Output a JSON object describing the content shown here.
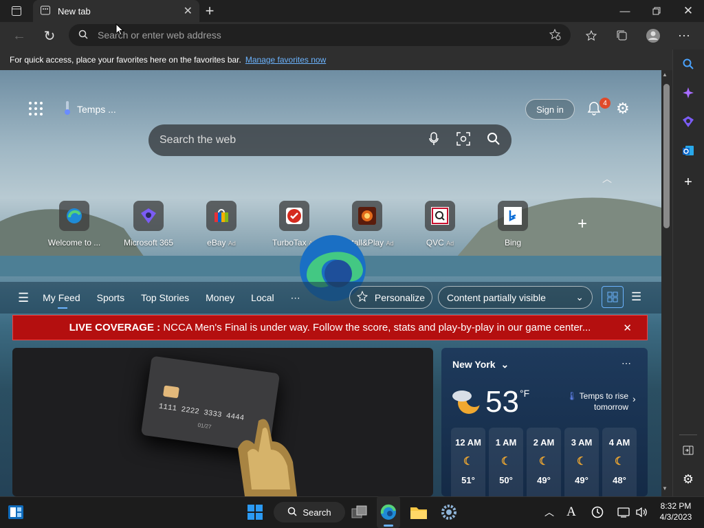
{
  "browser": {
    "tab_title": "New tab",
    "address_placeholder": "Search or enter web address",
    "favorites_bar_text": "For quick access, place your favorites here on the favorites bar.",
    "favorites_link": "Manage favorites now"
  },
  "newtab": {
    "weather_chip": "Temps ...",
    "sign_in": "Sign in",
    "notification_count": "4",
    "search_placeholder": "Search the web",
    "tiles": [
      {
        "label": "Welcome to ...",
        "ad": ""
      },
      {
        "label": "Microsoft 365",
        "ad": ""
      },
      {
        "label": "eBay",
        "ad": "Ad"
      },
      {
        "label": "TurboTax",
        "ad": "Ad"
      },
      {
        "label": "Install&Play",
        "ad": "Ad"
      },
      {
        "label": "QVC",
        "ad": "Ad"
      },
      {
        "label": "Bing",
        "ad": ""
      }
    ],
    "feed_tabs": [
      "My Feed",
      "Sports",
      "Top Stories",
      "Money",
      "Local"
    ],
    "personalize": "Personalize",
    "content_visibility": "Content partially visible",
    "banner_label": "LIVE COVERAGE :",
    "banner_text": "NCCA Men's Final is under way. Follow the score, stats and play-by-play in our game center...",
    "card_numbers": "1111  2222  3333  4444",
    "card_expiry": "01/27"
  },
  "weather": {
    "location": "New York",
    "temp": "53",
    "unit": "°F",
    "note": "Temps to rise tomorrow",
    "hours": [
      {
        "time": "12 AM",
        "temp": "51°"
      },
      {
        "time": "1 AM",
        "temp": "50°"
      },
      {
        "time": "2 AM",
        "temp": "49°"
      },
      {
        "time": "3 AM",
        "temp": "49°"
      },
      {
        "time": "4 AM",
        "temp": "48°"
      }
    ]
  },
  "taskbar": {
    "search_label": "Search",
    "time": "8:32 PM",
    "date": "4/3/2023"
  },
  "colors": {
    "accent": "#6cb4ff",
    "banner": "#b40f0f",
    "badge": "#e04a2a"
  }
}
